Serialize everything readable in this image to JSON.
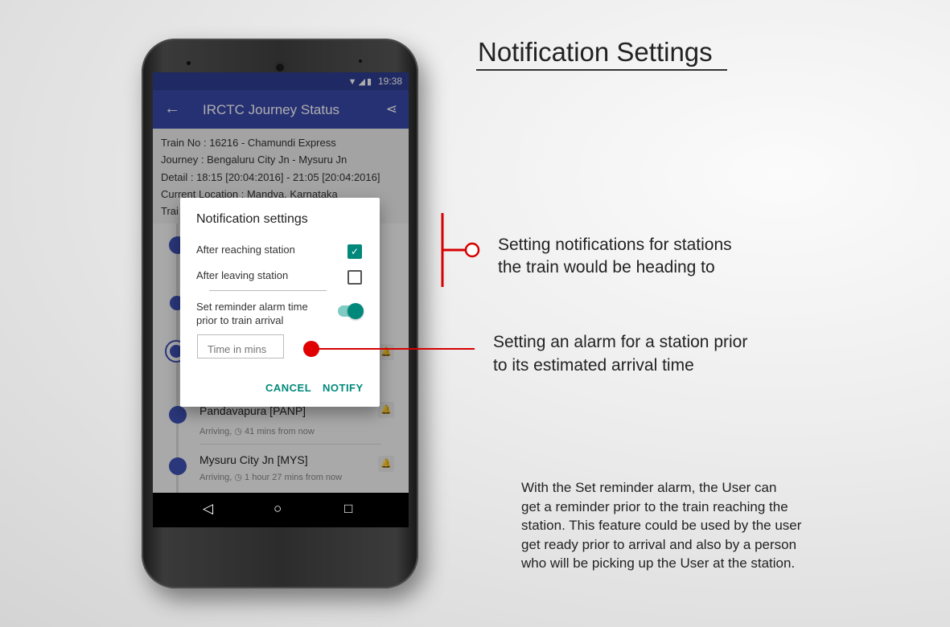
{
  "heading": "Notification Settings",
  "statusbar": {
    "icons": "▼◢▮",
    "time": "19:38"
  },
  "appbar": {
    "back_icon": "arrow-left-icon",
    "title": "IRCTC Journey Status",
    "share_icon": "share-icon"
  },
  "journey_info": {
    "train_no": "Train No : 16216 - Chamundi Express",
    "journey": "Journey : Bengaluru City Jn - Mysuru Jn",
    "detail": "Detail : 18:15 [20:04:2016] - 21:05 [20:04:2016]",
    "location": "Current Location : Mandya, Karnataka",
    "partial": "Trai"
  },
  "stations": [
    {
      "name": "Pandavapura [PANP]",
      "sub": "Arriving, ◷ 41 mins from now"
    },
    {
      "name": "Mysuru City Jn [MYS]",
      "sub": "Arriving, ◷ 1 hour 27 mins from now"
    }
  ],
  "dialog": {
    "title": "Notification settings",
    "after_reaching": {
      "label": "After reaching station",
      "checked": true
    },
    "after_leaving": {
      "label": "After leaving station",
      "checked": false
    },
    "reminder_label_1": "Set reminder alarm time",
    "reminder_label_2": "prior to train arrival",
    "reminder_on": true,
    "time_placeholder": "Time in mins",
    "cancel": "CANCEL",
    "notify": "NOTIFY"
  },
  "annotations": {
    "stations_line1": "Setting notifications for stations",
    "stations_line2": "the train would be heading to",
    "alarm_line1": "Setting an alarm for a station prior",
    "alarm_line2": "to its estimated arrival time"
  },
  "description": [
    "With the Set reminder alarm, the User can",
    "get a reminder prior to the train reaching the",
    "station. This feature could be used by the user",
    "get ready prior to arrival and also by a person",
    "who will be picking up the User at the station."
  ],
  "colors": {
    "primary": "#3949ab",
    "primary_dark": "#2e3d92",
    "accent": "#00897b",
    "annotation_red": "#d60000"
  }
}
